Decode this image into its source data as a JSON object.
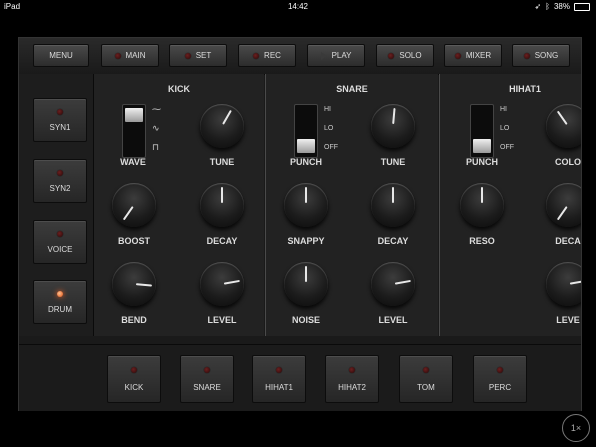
{
  "status_bar": {
    "device": "iPad",
    "time": "14:42",
    "battery": "38%"
  },
  "top_bar": {
    "menu": "MENU",
    "buttons": [
      {
        "label": "MAIN"
      },
      {
        "label": "SET"
      },
      {
        "label": "REC"
      },
      {
        "label": "PLAY"
      },
      {
        "label": "SOLO"
      },
      {
        "label": "MIXER"
      },
      {
        "label": "SONG"
      }
    ]
  },
  "sidebar": {
    "items": [
      {
        "label": "SYN1",
        "led": "off"
      },
      {
        "label": "SYN2",
        "led": "off"
      },
      {
        "label": "VOICE",
        "led": "off"
      },
      {
        "label": "DRUM",
        "led": "on"
      }
    ]
  },
  "panels": {
    "kick": {
      "title": "KICK",
      "wave_label": "WAVE",
      "wave_icons": [
        "triangle-wave-icon",
        "sine-wave-icon",
        "square-wave-icon"
      ],
      "wave_glyphs": [
        "⁓",
        "∿",
        "⊓"
      ],
      "tune_label": "TUNE",
      "boost_label": "BOOST",
      "decay_label": "DECAY",
      "bend_label": "BEND",
      "level_label": "LEVEL"
    },
    "snare": {
      "title": "SNARE",
      "punch_label": "PUNCH",
      "switch_options": [
        "HI",
        "LO",
        "OFF"
      ],
      "tune_label": "TUNE",
      "snappy_label": "SNAPPY",
      "decay_label": "DECAY",
      "noise_label": "NOISE",
      "level_label": "LEVEL"
    },
    "hihat1": {
      "title": "HIHAT1",
      "punch_label": "PUNCH",
      "switch_options": [
        "HI",
        "LO",
        "OFF"
      ],
      "color_label": "COLO",
      "reso_label": "RESO",
      "decay_label": "DECA",
      "level_label": "LEVE"
    }
  },
  "bottom_bar": {
    "buttons": [
      {
        "label": "KICK"
      },
      {
        "label": "SNARE"
      },
      {
        "label": "HIHAT1"
      },
      {
        "label": "HIHAT2"
      },
      {
        "label": "TOM"
      },
      {
        "label": "PERC"
      }
    ]
  },
  "zoom": "1×",
  "colors": {
    "led_on": "#ff6020",
    "led_off": "#4a1010",
    "background": "#1a1a1a"
  }
}
